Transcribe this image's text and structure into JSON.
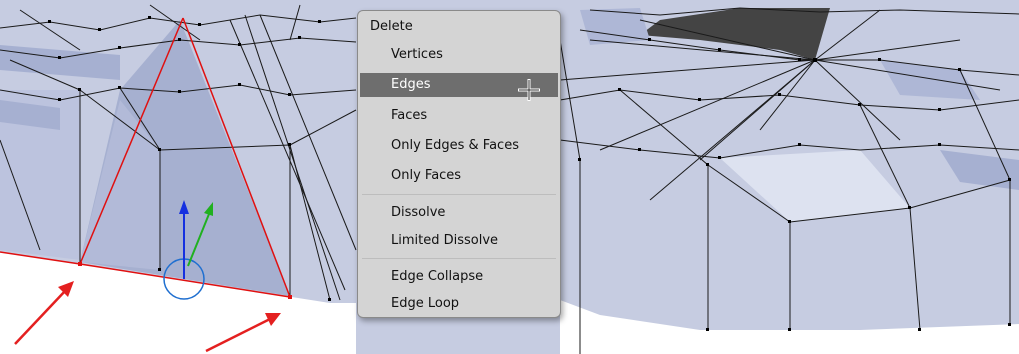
{
  "colors": {
    "mesh_fill": "#c6cce1",
    "mesh_dark_fill": "#a0aacc",
    "mesh_light_fill": "#dde2f0",
    "wire": "#1a1a1a",
    "selected_edge": "#e01010",
    "arrow": "#e42020",
    "menu_bg": "#d4d4d4",
    "menu_highlight": "#6e6e6e",
    "gizmo_x": "#1f6fd0",
    "gizmo_z": "#1530e0",
    "gizmo_y": "#20b020"
  },
  "context_menu": {
    "title": "Delete",
    "highlighted": "Edges",
    "items": [
      {
        "label": "Vertices"
      },
      {
        "label": "Edges"
      },
      {
        "label": "Faces"
      },
      {
        "label": "Only Edges & Faces"
      },
      {
        "label": "Only Faces"
      },
      {
        "label": "Dissolve"
      },
      {
        "label": "Limited Dissolve"
      },
      {
        "label": "Edge Collapse"
      },
      {
        "label": "Edge Loop"
      }
    ]
  }
}
